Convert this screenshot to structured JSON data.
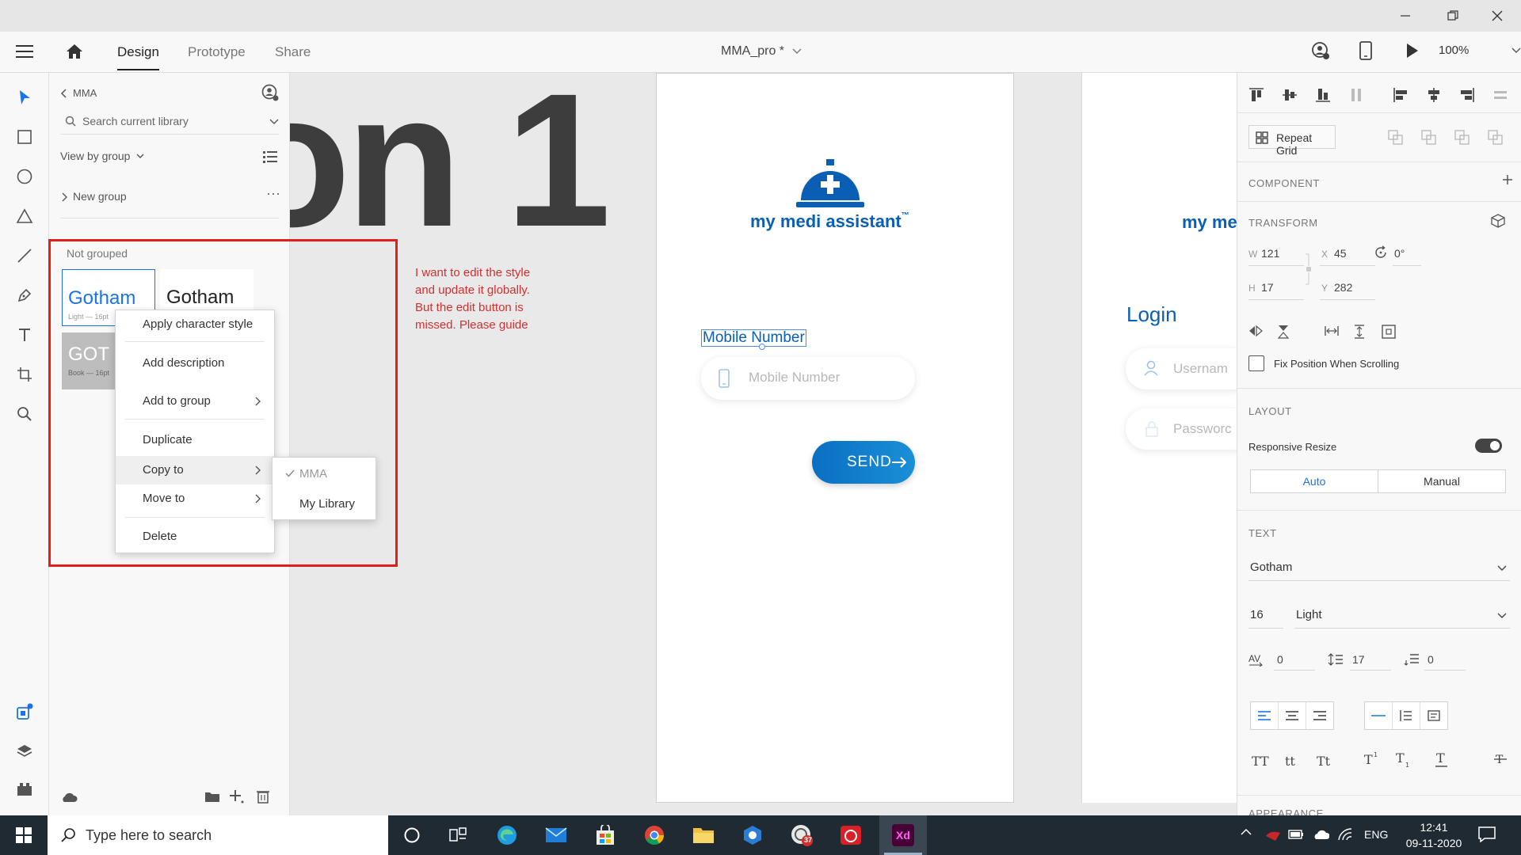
{
  "app": {
    "document_title": "MMA_pro *",
    "zoom": "100%",
    "nav_tabs": [
      "Design",
      "Prototype",
      "Share"
    ],
    "active_tab": "Design"
  },
  "assets": {
    "library_name": "MMA",
    "search_placeholder": "Search current library",
    "view_label": "View by group",
    "group_name": "New group",
    "ungrouped_label": "Not grouped",
    "styles": [
      {
        "preview": "Gotham",
        "caption": "Light — 16pt"
      },
      {
        "preview": "Gotham",
        "caption": ""
      },
      {
        "preview": "GOT",
        "caption": "Book — 16pt"
      }
    ]
  },
  "context_menu": {
    "items": [
      "Apply character style",
      "Add description",
      "Add to group",
      "Duplicate",
      "Copy to",
      "Move to",
      "Delete"
    ],
    "submenu": [
      "MMA",
      "My Library"
    ],
    "checked": "MMA"
  },
  "annotation": {
    "lines": [
      "I want to edit the style",
      "and update it globally.",
      "But the edit button is",
      "missed. Please guide"
    ],
    "color": "#d32f2f"
  },
  "canvas": {
    "big_text": "on 1",
    "logo_text": "my medi assistant",
    "trademark": "™",
    "logo_text_partial": "my me",
    "selected_text": "Mobile Number",
    "mobile_placeholder": "Mobile Number",
    "send_label": "SEND",
    "login_title": "Login",
    "username_placeholder": "Usernam",
    "password_placeholder": "Passworc",
    "brand_color": "#0a5fb4"
  },
  "props": {
    "repeat_grid": "Repeat Grid",
    "component_label": "COMPONENT",
    "transform_label": "TRANSFORM",
    "w_label": "W",
    "w": "121",
    "x_label": "X",
    "x": "45",
    "h_label": "H",
    "h": "17",
    "y_label": "Y",
    "y": "282",
    "rotation": "0°",
    "fix_position": "Fix Position When Scrolling",
    "layout_label": "LAYOUT",
    "responsive_resize": "Responsive Resize",
    "resize_modes": [
      "Auto",
      "Manual"
    ],
    "text_label": "TEXT",
    "font": "Gotham",
    "font_size": "16",
    "font_weight": "Light",
    "char_spacing": "0",
    "line_spacing": "17",
    "para_spacing": "0",
    "case_buttons": [
      "TT",
      "tt",
      "Tt"
    ],
    "appearance_label": "APPEARANCE"
  },
  "taskbar": {
    "search_placeholder": "Type here to search",
    "language": "ENG",
    "time": "12:41",
    "date": "09-11-2020",
    "badge": "37"
  }
}
